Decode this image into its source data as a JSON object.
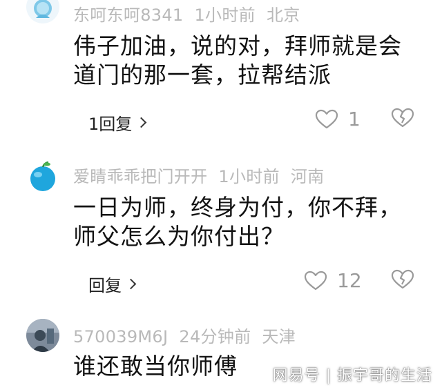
{
  "comments": [
    {
      "username": "东呵东呵8341",
      "time": "1小时前",
      "location": "北京",
      "text": "伟子加油，说的对，拜师就是会道门的那一套，拉帮结派",
      "reply_label": "1回复",
      "likes": "1"
    },
    {
      "username": "爱睛乖乖把门开开",
      "time": "1小时前",
      "location": "河南",
      "text": "一日为师，终身为付，你不拜，师父怎么为你付出？",
      "reply_label": "回复",
      "likes": "12"
    },
    {
      "username": "570039M6J",
      "time": "24分钟前",
      "location": "天津",
      "text": "谁还敢当你师傅"
    }
  ],
  "watermark": "网易号 | 振宇哥的生活",
  "icons": {
    "like": "heart-outline-icon",
    "dislike": "broken-heart-icon",
    "reply": "chevron-right-icon"
  },
  "colors": {
    "meta": "#b9b9b9",
    "icon": "#9a9a9a"
  }
}
